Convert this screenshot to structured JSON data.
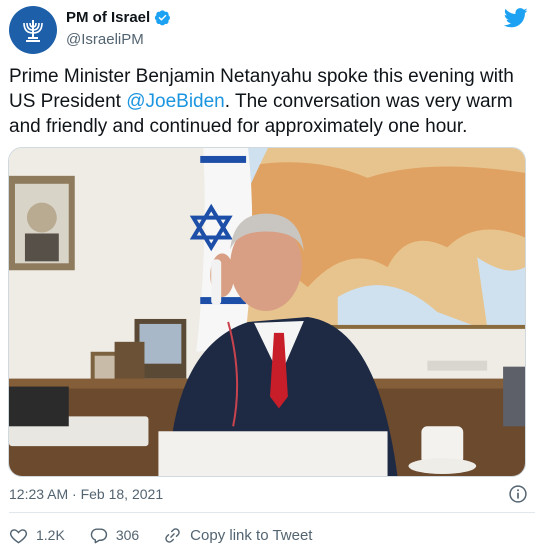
{
  "account": {
    "display_name": "PM of Israel",
    "handle": "@IsraeliPM",
    "avatar_icon": "menorah-emblem-icon",
    "verified_icon": "verified-badge-icon"
  },
  "tweet": {
    "text_before": "Prime Minister Benjamin Netanyahu spoke this evening with US President ",
    "mention": "@JoeBiden",
    "text_after": ". The conversation was very warm and friendly and continued for approximately one hour.",
    "timestamp": "12:23 AM · Feb 18, 2021"
  },
  "actions": {
    "likes": "1.2K",
    "replies": "306",
    "copy_link": "Copy link to Tweet"
  },
  "colors": {
    "link": "#1b95e0",
    "twitter_blue": "#1da1f2",
    "muted": "#536471"
  }
}
